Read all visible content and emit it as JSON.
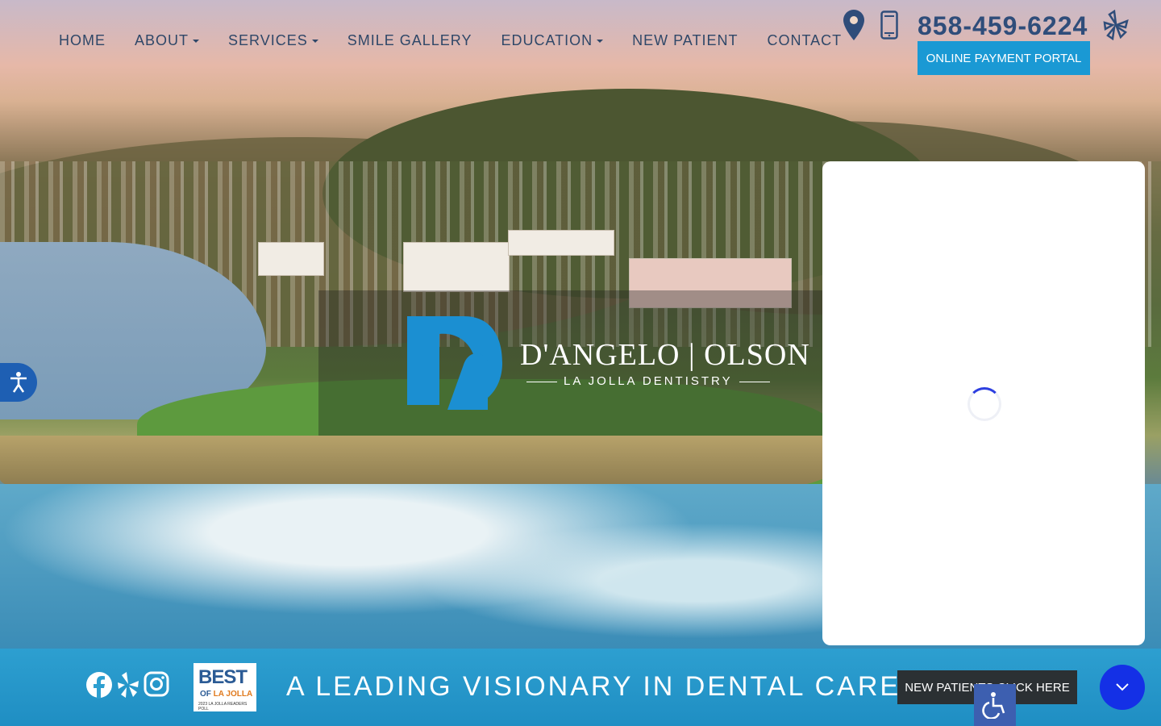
{
  "nav": {
    "items": [
      {
        "label": "HOME",
        "dropdown": false
      },
      {
        "label": "ABOUT",
        "dropdown": true
      },
      {
        "label": "SERVICES",
        "dropdown": true
      },
      {
        "label": "SMILE GALLERY",
        "dropdown": false
      },
      {
        "label": "EDUCATION",
        "dropdown": true
      },
      {
        "label": "NEW PATIENT",
        "dropdown": false
      },
      {
        "label": "CONTACT",
        "dropdown": false
      }
    ]
  },
  "header": {
    "phone": "858-459-6224",
    "payment_button": "ONLINE PAYMENT PORTAL",
    "icons": [
      "map-pin-icon",
      "mobile-phone-icon",
      "yelp-icon"
    ]
  },
  "logo": {
    "name": "D'ANGELO | OLSON",
    "subtitle": "LA JOLLA DENTISTRY"
  },
  "footer_bar": {
    "tagline": "A LEADING VISIONARY IN DENTAL CARE.",
    "new_patient_button": "NEW PATIENTS CLICK HERE",
    "badge": {
      "best": "BEST",
      "of": "OF",
      "place": "LA JOLLA",
      "small": "2023 LA JOLLA READERS POLL"
    },
    "social_icons": [
      "facebook-icon",
      "yelp-icon",
      "instagram-icon"
    ]
  },
  "colors": {
    "nav_text": "#2f4768",
    "accent_blue": "#1a99d4",
    "bar_blue": "#2d9fd0",
    "scroll_button": "#1430e6",
    "dark_button": "#2b3033"
  }
}
